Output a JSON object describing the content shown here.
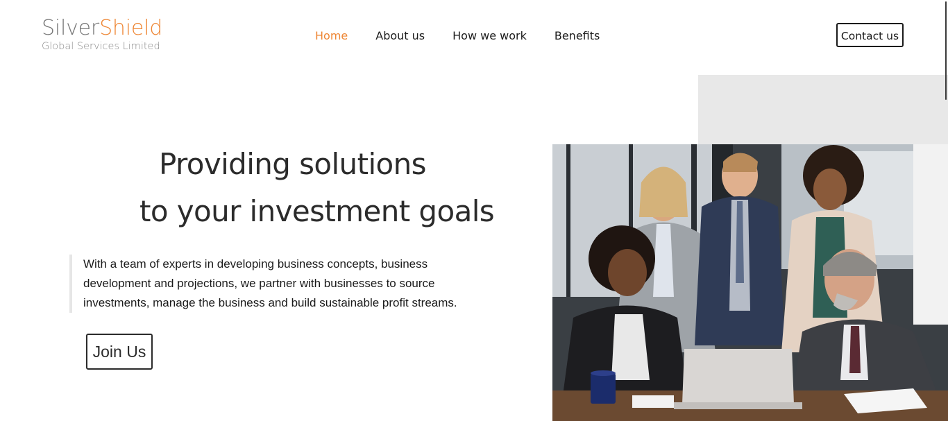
{
  "header": {
    "logo": {
      "name_part1": "Silver",
      "name_part2": "Shield",
      "subtitle": "Global Services Limited"
    },
    "nav": [
      {
        "label": "Home",
        "active": true
      },
      {
        "label": "About us",
        "active": false
      },
      {
        "label": "How we work",
        "active": false
      },
      {
        "label": "Benefits",
        "active": false
      }
    ],
    "contact_label": "Contact us"
  },
  "hero": {
    "headline_line1": "Providing solutions",
    "headline_line2": "to your investment goals",
    "description_lines": [
      "With a team of experts in developing business concepts, business",
      "development and projections, we partner with businesses to source",
      "investments, manage the business and build sustainable profit streams."
    ],
    "cta_label": "Join Us",
    "photo_alt": "team-meeting-photo"
  },
  "colors": {
    "accent": "#ee8634",
    "text": "#1a1a1a",
    "muted_gray": "#888888",
    "panel_gray": "#e8e8e8"
  }
}
